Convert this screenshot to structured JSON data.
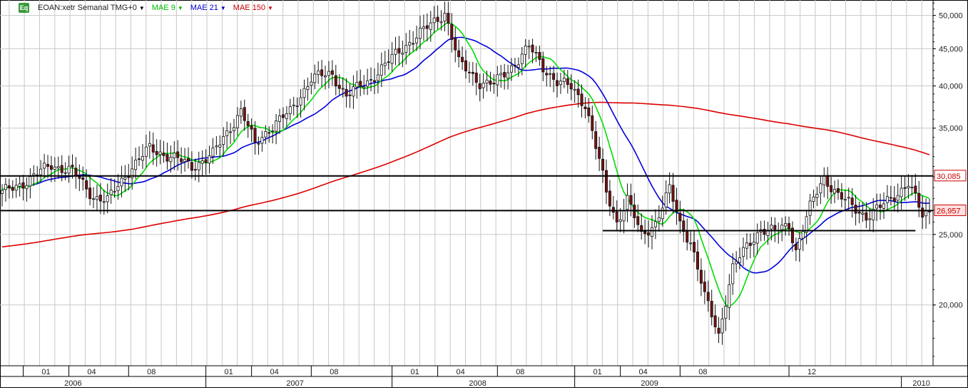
{
  "legend": {
    "icon_label": "Eq",
    "symbol": "EOAN:xetr Semanal TMG+0",
    "ma9": "MAE 9",
    "ma21": "MAE 21",
    "ma150": "MAE 150",
    "arrow": "▼"
  },
  "colors": {
    "ma9": "#00dd00",
    "ma21": "#0000dd",
    "ma150": "#dd0000",
    "candle_up": "#ffffff",
    "candle_down": "#7a1010",
    "level_line": "#000000",
    "grid": "#c8c8c8"
  },
  "chart_data": {
    "type": "candlestick",
    "y_scale": "log",
    "ylim": [
      16500,
      52500
    ],
    "y_ticks": [
      {
        "value": 50000,
        "label": "50,000"
      },
      {
        "value": 45000,
        "label": "45,000"
      },
      {
        "value": 40000,
        "label": "40,000"
      },
      {
        "value": 35000,
        "label": "35,000"
      },
      {
        "value": 25000,
        "label": "25,000"
      },
      {
        "value": 20000,
        "label": "20,000"
      }
    ],
    "price_labels": [
      {
        "value": 30085,
        "label": "30,085",
        "style": "outline"
      },
      {
        "value": 26957,
        "label": "26,957",
        "style": "filled"
      }
    ],
    "horizontal_levels": [
      {
        "value": 30085,
        "from": "2005-10",
        "to": "2010-02"
      },
      {
        "value": 26957,
        "from": "2005-10",
        "to": "2010-02"
      },
      {
        "value": 25300,
        "from": "2008-07",
        "to": "2010-01"
      }
    ],
    "x_month_ticks": [
      "01",
      "04",
      "08",
      "01",
      "04",
      "08",
      "01",
      "04",
      "08",
      "01",
      "04",
      "08",
      "12"
    ],
    "x_year_labels": [
      "2006",
      "2007",
      "2008",
      "2009",
      "2010"
    ],
    "price_path": [
      {
        "week": 0,
        "close": 28500
      },
      {
        "week": 8,
        "close": 29800
      },
      {
        "week": 14,
        "close": 31200
      },
      {
        "week": 20,
        "close": 30500
      },
      {
        "week": 26,
        "close": 28200
      },
      {
        "week": 30,
        "close": 27800
      },
      {
        "week": 36,
        "close": 30600
      },
      {
        "week": 42,
        "close": 32800
      },
      {
        "week": 48,
        "close": 32000
      },
      {
        "week": 54,
        "close": 31000
      },
      {
        "week": 60,
        "close": 32200
      },
      {
        "week": 64,
        "close": 34500
      },
      {
        "week": 68,
        "close": 37000
      },
      {
        "week": 72,
        "close": 33200
      },
      {
        "week": 76,
        "close": 35000
      },
      {
        "week": 82,
        "close": 36800
      },
      {
        "week": 88,
        "close": 41000
      },
      {
        "week": 94,
        "close": 41500
      },
      {
        "week": 98,
        "close": 38800
      },
      {
        "week": 104,
        "close": 40500
      },
      {
        "week": 110,
        "close": 43200
      },
      {
        "week": 116,
        "close": 46000
      },
      {
        "week": 122,
        "close": 48500
      },
      {
        "week": 126,
        "close": 50500
      },
      {
        "week": 130,
        "close": 43000
      },
      {
        "week": 136,
        "close": 40500
      },
      {
        "week": 140,
        "close": 40200
      },
      {
        "week": 146,
        "close": 43000
      },
      {
        "week": 150,
        "close": 45200
      },
      {
        "week": 154,
        "close": 42500
      },
      {
        "week": 158,
        "close": 40500
      },
      {
        "week": 162,
        "close": 39800
      },
      {
        "week": 166,
        "close": 37800
      },
      {
        "week": 169,
        "close": 33000
      },
      {
        "week": 172,
        "close": 28500
      },
      {
        "week": 175,
        "close": 26000
      },
      {
        "week": 178,
        "close": 28000
      },
      {
        "week": 182,
        "close": 24800
      },
      {
        "week": 186,
        "close": 26000
      },
      {
        "week": 190,
        "close": 28800
      },
      {
        "week": 193,
        "close": 25800
      },
      {
        "week": 196,
        "close": 24500
      },
      {
        "week": 200,
        "close": 20500
      },
      {
        "week": 204,
        "close": 18200
      },
      {
        "week": 208,
        "close": 22500
      },
      {
        "week": 212,
        "close": 24000
      },
      {
        "week": 216,
        "close": 25500
      },
      {
        "week": 220,
        "close": 25200
      },
      {
        "week": 224,
        "close": 25800
      },
      {
        "week": 226,
        "close": 23800
      },
      {
        "week": 230,
        "close": 27200
      },
      {
        "week": 234,
        "close": 30000
      },
      {
        "week": 238,
        "close": 28300
      },
      {
        "week": 242,
        "close": 27300
      },
      {
        "week": 246,
        "close": 26500
      },
      {
        "week": 250,
        "close": 27200
      },
      {
        "week": 254,
        "close": 28300
      },
      {
        "week": 258,
        "close": 29400
      },
      {
        "week": 262,
        "close": 26500
      },
      {
        "week": 264,
        "close": 26957
      }
    ],
    "series": [
      {
        "name": "MAE 9",
        "period": 9
      },
      {
        "name": "MAE 21",
        "period": 21
      },
      {
        "name": "MAE 150",
        "period": 150
      }
    ]
  }
}
